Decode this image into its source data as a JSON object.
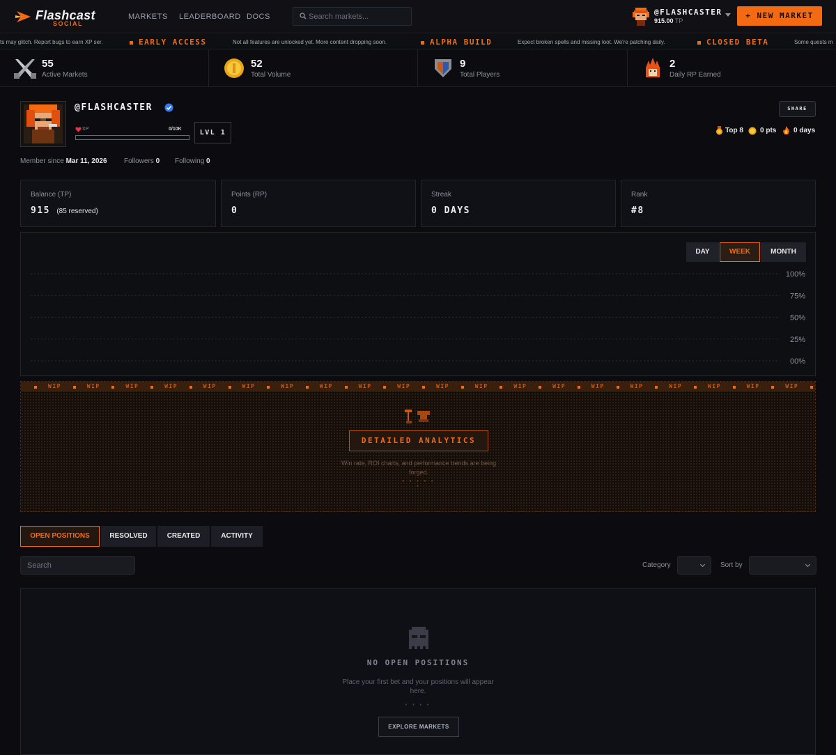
{
  "brand": {
    "name": "Flashcast",
    "sub": "SOCIAL"
  },
  "nav": {
    "markets": "MARKETS",
    "leaderboard": "LEADERBOARD",
    "docs": "DOCS"
  },
  "search": {
    "placeholder": "Search markets..."
  },
  "user": {
    "handle": "@FLASHCASTER",
    "tp_amount": "915.00",
    "tp_unit": "TP"
  },
  "new_market": "+ NEW MARKET",
  "ticker": [
    {
      "kind": "text",
      "text": "ts may glitch. Report bugs to earn XP ser."
    },
    {
      "kind": "head",
      "text": "EARLY ACCESS"
    },
    {
      "kind": "text",
      "text": "Not all features are unlocked yet. More content dropping soon."
    },
    {
      "kind": "head",
      "text": "ALPHA BUILD"
    },
    {
      "kind": "text",
      "text": "Expect broken spells and missing loot. We're patching daily."
    },
    {
      "kind": "head",
      "text": "CLOSED BETA"
    },
    {
      "kind": "text",
      "text": "Some quests m"
    }
  ],
  "stats": [
    {
      "icon": "crossed-swords-icon",
      "value": "55",
      "label": "Active Markets"
    },
    {
      "icon": "gold-coin-icon",
      "value": "52",
      "label": "Total Volume"
    },
    {
      "icon": "shield-icon",
      "value": "9",
      "label": "Total Players"
    },
    {
      "icon": "fire-skull-icon",
      "value": "2",
      "label": "Daily RP Earned"
    }
  ],
  "profile": {
    "handle": "@FLASHCASTER",
    "xp_label": "XP",
    "xp_value": "0/10K",
    "xp_fraction": 0,
    "level": "LVL 1",
    "share": "SHARE",
    "badges": {
      "top": "Top 8",
      "pts": "0 pts",
      "days": "0 days"
    },
    "member_since_label": "Member since",
    "member_since": "Mar 11, 2026",
    "followers_label": "Followers",
    "followers": "0",
    "following_label": "Following",
    "following": "0"
  },
  "cards": [
    {
      "title": "Balance (TP)",
      "value": "915",
      "note": "(85 reserved)"
    },
    {
      "title": "Points (RP)",
      "value": "0",
      "note": ""
    },
    {
      "title": "Streak",
      "value": "0 DAYS",
      "note": ""
    },
    {
      "title": "Rank",
      "value": "#8",
      "note": ""
    }
  ],
  "chart_ranges": {
    "day": "DAY",
    "week": "WEEK",
    "month": "MONTH",
    "active": "WEEK"
  },
  "chart_data": {
    "type": "line",
    "yticks": [
      "100%",
      "75%",
      "50%",
      "25%",
      "00%"
    ],
    "ylim": [
      0,
      100
    ],
    "grid": true,
    "series": []
  },
  "wip": {
    "strip_text": "WIP",
    "title": "DETAILED ANALYTICS",
    "description": "Win rate, ROI charts, and performance trends are being forged.",
    "dots": "• • • • • •"
  },
  "tabs": [
    {
      "label": "OPEN POSITIONS",
      "active": true
    },
    {
      "label": "RESOLVED",
      "active": false
    },
    {
      "label": "CREATED",
      "active": false
    },
    {
      "label": "ACTIVITY",
      "active": false
    }
  ],
  "filters": {
    "search_placeholder": "Search",
    "category_label": "Category",
    "sort_label": "Sort by"
  },
  "empty": {
    "title": "NO OPEN POSITIONS",
    "description": "Place your first bet and your positions will appear here.",
    "dots": "• • • •",
    "button": "EXPLORE MARKETS"
  },
  "colors": {
    "accent": "#f46a12",
    "bg": "#0c0c10",
    "panel": "#101116",
    "verified": "#2f7bf6"
  }
}
